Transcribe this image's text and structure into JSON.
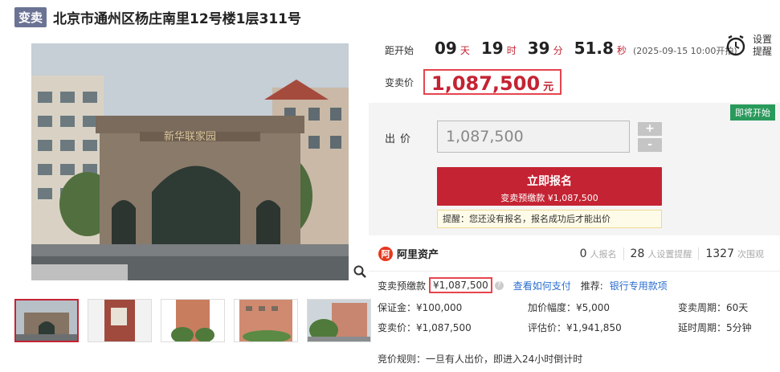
{
  "header": {
    "badge": "变卖",
    "title": "北京市通州区杨庄南里12号楼1层311号"
  },
  "countdown": {
    "label": "距开始",
    "days": "09",
    "days_unit": "天",
    "hours": "19",
    "hours_unit": "时",
    "minutes": "39",
    "minutes_unit": "分",
    "seconds": "51.8",
    "seconds_unit": "秒",
    "start_note": "(2025-09-15 10:00开拍)"
  },
  "price": {
    "label": "变卖价",
    "value": "1,087,500",
    "unit": "元"
  },
  "reminder": {
    "line1": "设置",
    "line2": "提醒",
    "icon": "alarm-clock-icon"
  },
  "bid": {
    "status_tag": "即将开始",
    "label": "出价",
    "input_value": "1,087,500",
    "plus": "+",
    "minus": "-",
    "signup_main": "立即报名",
    "signup_sub": "变卖预缴款 ¥1,087,500",
    "notice": "提醒：您还没有报名，报名成功后才能出价"
  },
  "brand": {
    "logo_text": "阿",
    "name": "阿里资产"
  },
  "stats": [
    {
      "num": "0",
      "label": "人报名"
    },
    {
      "num": "28",
      "label": "人设置提醒"
    },
    {
      "num": "1327",
      "label": "次围观"
    }
  ],
  "details": {
    "deposit_label": "变卖预缴款",
    "deposit_value": "¥1,087,500",
    "pay_link": "查看如何支付",
    "recommend_label": "推荐:",
    "recommend_link": "银行专用款项",
    "guarantee": "保证金：¥100,000",
    "increment": "加价幅度：¥5,000",
    "period": "变卖周期：60天",
    "sale_price": "变卖价：¥1,087,500",
    "appraisal": "评估价：¥1,941,850",
    "extension": "延时周期：5分钟",
    "rule": "竞价规则：一旦有人出价，即进入24小时倒计时"
  },
  "gallery": {
    "main_alt": "新华联家园 entrance gate photo",
    "thumb_count": 5
  },
  "colors": {
    "accent": "#c42333",
    "badge": "#6b7394",
    "status": "#2a9a5c",
    "link": "#2a6ecf"
  }
}
